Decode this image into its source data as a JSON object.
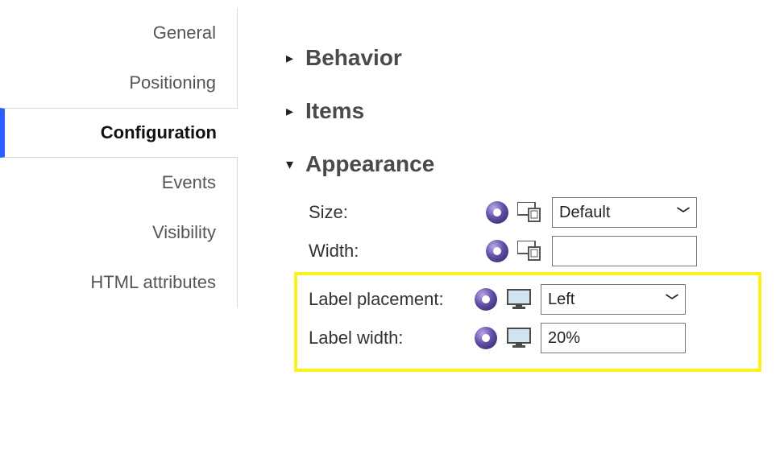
{
  "sidebar": {
    "items": [
      {
        "label": "General"
      },
      {
        "label": "Positioning"
      },
      {
        "label": "Configuration",
        "selected": true
      },
      {
        "label": "Events"
      },
      {
        "label": "Visibility"
      },
      {
        "label": "HTML attributes"
      }
    ]
  },
  "sections": {
    "behavior": {
      "title": "Behavior",
      "expanded": false
    },
    "items": {
      "title": "Items",
      "expanded": false
    },
    "appearance": {
      "title": "Appearance",
      "expanded": true,
      "props": {
        "size": {
          "label": "Size:",
          "value": "Default",
          "type": "select"
        },
        "width": {
          "label": "Width:",
          "value": "",
          "type": "input"
        },
        "label_placement": {
          "label": "Label placement:",
          "value": "Left",
          "type": "select"
        },
        "label_width": {
          "label": "Label width:",
          "value": "20%",
          "type": "input"
        }
      }
    }
  },
  "glyphs": {
    "caret_right": "▸",
    "caret_down": "▾",
    "chevron_down": "⌄"
  }
}
